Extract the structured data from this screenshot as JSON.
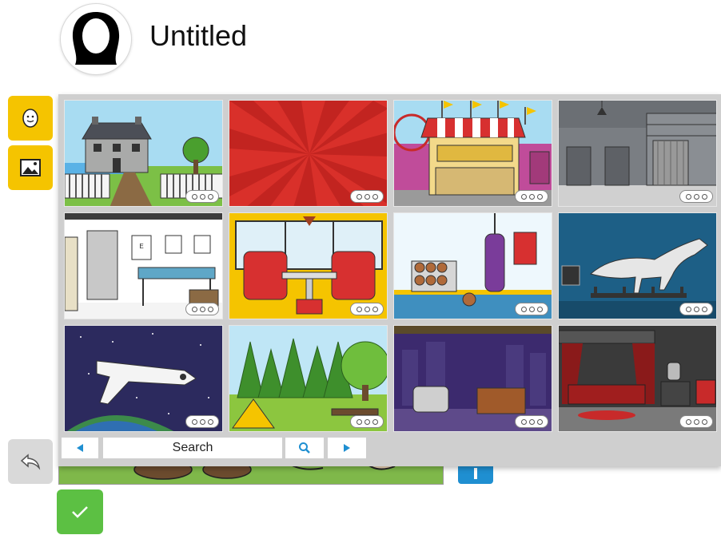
{
  "header": {
    "title": "Untitled",
    "avatar_icon": "user-silhouette-icon"
  },
  "toolbar": {
    "character_icon": "smiley-face-icon",
    "scene_icon": "image-icon"
  },
  "scene_library": {
    "thumbnails": [
      {
        "scene": "country-house"
      },
      {
        "scene": "red-starburst"
      },
      {
        "scene": "fairground-stall"
      },
      {
        "scene": "warehouse-loading-bay"
      },
      {
        "scene": "doctor-office"
      },
      {
        "scene": "diner-booth"
      },
      {
        "scene": "boxing-gym"
      },
      {
        "scene": "museum-dinosaur"
      },
      {
        "scene": "space-shuttle"
      },
      {
        "scene": "forest-campsite"
      },
      {
        "scene": "talk-show-set"
      },
      {
        "scene": "theater-bedroom"
      }
    ],
    "more_icon": "more-options-icon"
  },
  "search": {
    "value": "Search",
    "prev_icon": "left-arrow-icon",
    "next_icon": "right-arrow-icon",
    "search_icon": "magnifier-icon"
  },
  "actions": {
    "back_icon": "undo-arrow-icon",
    "confirm_icon": "checkmark-icon"
  },
  "colors": {
    "tool_yellow": "#f5c400",
    "confirm_green": "#5cc043",
    "accent_blue": "#1f8fd1"
  }
}
